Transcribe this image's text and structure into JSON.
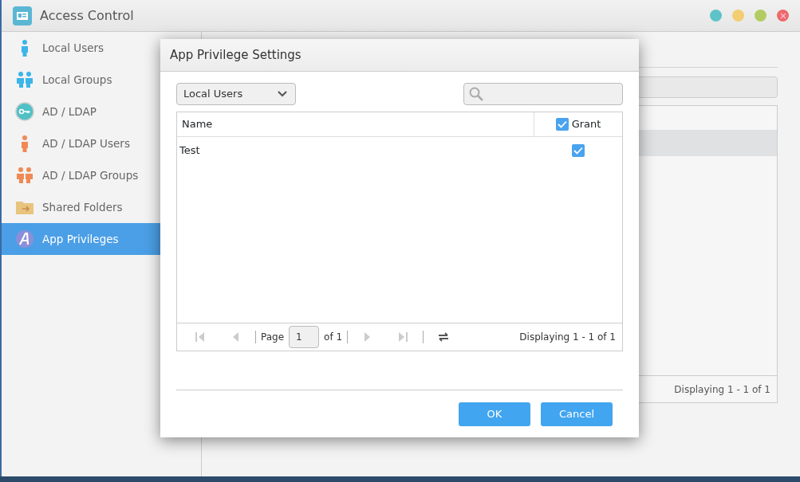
{
  "window": {
    "title": "Access Control",
    "controls": [
      {
        "kind": "minimize",
        "color": "#5ec3c9"
      },
      {
        "kind": "maximize",
        "color": "#f3cd72"
      },
      {
        "kind": "restore",
        "color": "#b2cc63"
      },
      {
        "kind": "close",
        "color": "#ec6a6a"
      }
    ]
  },
  "sidebar": {
    "items": [
      {
        "label": "Local Users",
        "kind": "user",
        "selected": false
      },
      {
        "label": "Local Groups",
        "kind": "group",
        "selected": false
      },
      {
        "label": "AD / LDAP",
        "kind": "key",
        "selected": false
      },
      {
        "label": "AD / LDAP Users",
        "kind": "useralt",
        "selected": false
      },
      {
        "label": "AD / LDAP Groups",
        "kind": "groupalt",
        "selected": false
      },
      {
        "label": "Shared Folders",
        "kind": "folder",
        "selected": false
      },
      {
        "label": "App Privileges",
        "kind": "app",
        "selected": true
      }
    ]
  },
  "main": {
    "status": "Displaying 1 - 1 of 1"
  },
  "dialog": {
    "title": "App Privilege Settings",
    "filter": {
      "value": "Local Users"
    },
    "table": {
      "columns": [
        {
          "label": "Name"
        },
        {
          "label": "Grant",
          "checked": true
        }
      ],
      "rows": [
        {
          "name": "Test",
          "granted": true
        }
      ]
    },
    "pager": {
      "page_label": "Page",
      "page": "1",
      "of": "of 1",
      "status": "Displaying 1 - 1 of 1"
    },
    "buttons": [
      "OK",
      "Cancel"
    ]
  }
}
